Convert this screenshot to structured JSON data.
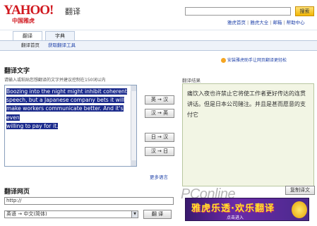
{
  "header": {
    "logo_text": "YAHOO!",
    "logo_sub": "中国雅虎",
    "product": "翻译",
    "search_button": "搜索",
    "links": [
      "雅虎首页",
      "雅虎大全",
      "邮箱",
      "帮助中心"
    ]
  },
  "tabs": [
    {
      "label": "翻译",
      "active": true
    },
    {
      "label": "字典",
      "active": false
    }
  ],
  "subnav": [
    "翻译首页",
    "获取翻译工具"
  ],
  "promo": "安装雅虎助手让网页翻译更轻松",
  "translate": {
    "title": "翻译文字",
    "hint": "请输入或粘贴您想翻译的文字并建议控制在150词以内",
    "source_lines": [
      "Boozing into the night might inhibit coherent",
      "speech, but a Japanese company bets it will",
      "make workers communicate better. And it's even",
      "willing to pay for it."
    ],
    "buttons": [
      "英 → 汉",
      "汉 → 英",
      "日 → 汉",
      "汉 → 日"
    ],
    "more_languages": "更多语言",
    "result_label": "翻译结果",
    "result_text": "痛饮入夜也许禁止它将使工作者更好传达的连贯讲话。但是日本公司赌注。并且是甚而愿意的支付它",
    "copy_button": "复制译文"
  },
  "webpage": {
    "title": "翻译网页",
    "url_value": "http://",
    "language_selected": "英语 → 中文(简体)",
    "translate_button": "翻 译"
  },
  "watermark": "PConline",
  "ad": {
    "headline": "雅虎乐透·欢乐翻译",
    "sub": "点击进入"
  },
  "colors": {
    "yahoo_red": "#d1181f",
    "link_blue": "#2244aa",
    "selection": "#1a2a8c",
    "result_bg": "#f2f5e4"
  }
}
